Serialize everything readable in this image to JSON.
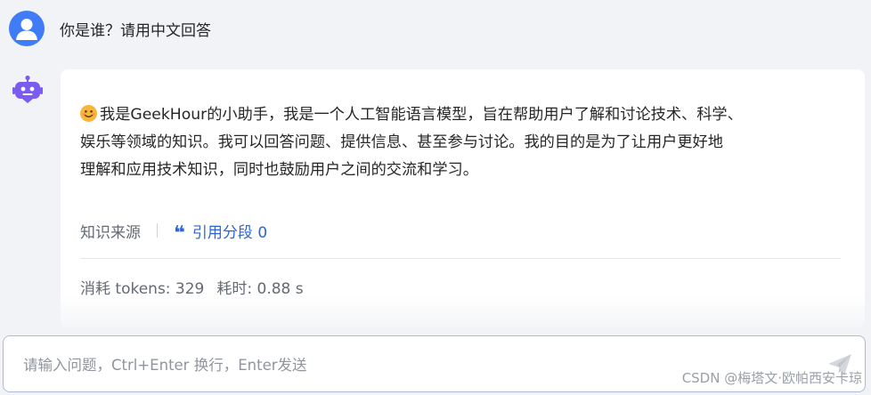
{
  "user": {
    "avatar_icon": "user-avatar-icon",
    "question": "你是谁？请用中文回答"
  },
  "bot": {
    "icon": "robot-icon",
    "emoji": "smiling-face-emoji",
    "answer_line_1": "我是GeekHour的小助手，我是一个人工智能语言模型，旨在帮助用户了解和讨论技术、科学、",
    "answer_line_2": "娱乐等领域的知识。我可以回答问题、提供信息、甚至参与讨论。我的目的是为了让用户更好地",
    "answer_line_3": "理解和应用技术知识，同时也鼓励用户之间的交流和学习。"
  },
  "sources": {
    "label": "知识来源",
    "quote_icon": "quote-icon",
    "citation_label": "引用分段 0"
  },
  "stats": {
    "tokens": "消耗 tokens: 329",
    "time": "耗时: 0.88 s"
  },
  "input": {
    "placeholder": "请输入问题，Ctrl+Enter 换行，Enter发送",
    "value": "",
    "send_icon": "send-icon"
  },
  "watermark": "CSDN @梅塔文·欧帕西安卡琼",
  "colors": {
    "accent": "#3f7cf6",
    "link": "#2b65d9",
    "bot_icon": "#7b5cf0"
  }
}
